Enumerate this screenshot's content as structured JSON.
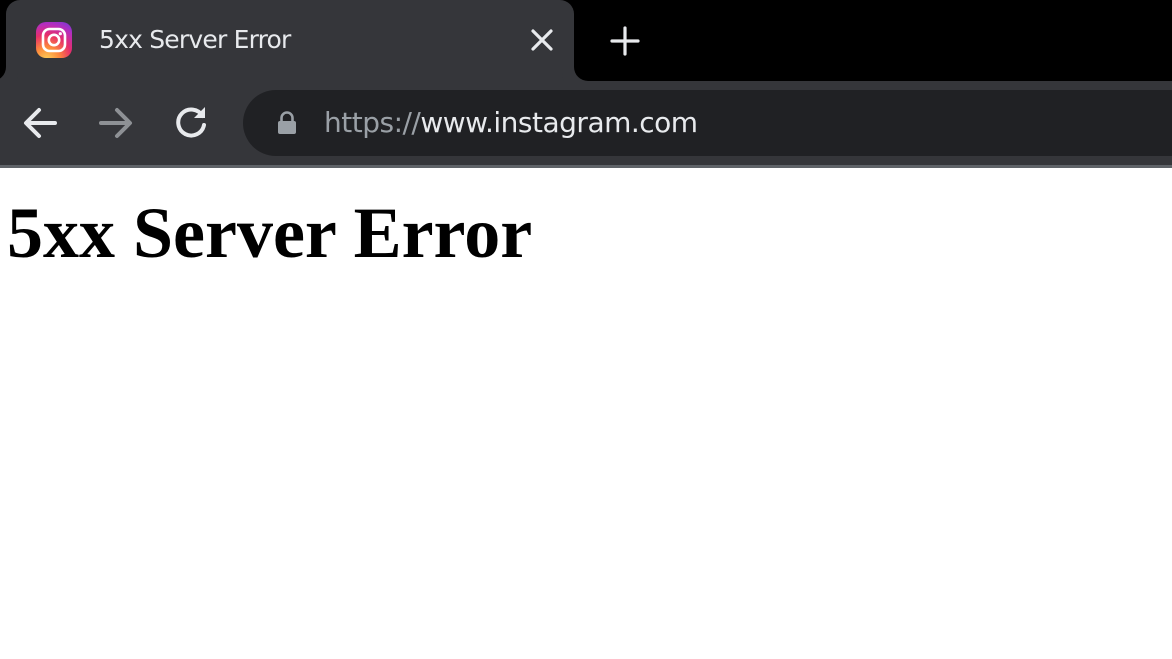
{
  "tab": {
    "title": "5xx Server Error",
    "favicon": "instagram-icon"
  },
  "toolbar": {
    "back_icon": "back-arrow-icon",
    "forward_icon": "forward-arrow-icon",
    "reload_icon": "reload-icon"
  },
  "address_bar": {
    "scheme": "https://",
    "host": "www.instagram.com",
    "security_icon": "lock-icon"
  },
  "page": {
    "heading": "5xx Server Error"
  },
  "colors": {
    "tabstrip": "#000000",
    "tab": "#35363a",
    "omnibox": "#202124",
    "text_light": "#e8eaed",
    "text_dim": "#9aa0a6"
  }
}
